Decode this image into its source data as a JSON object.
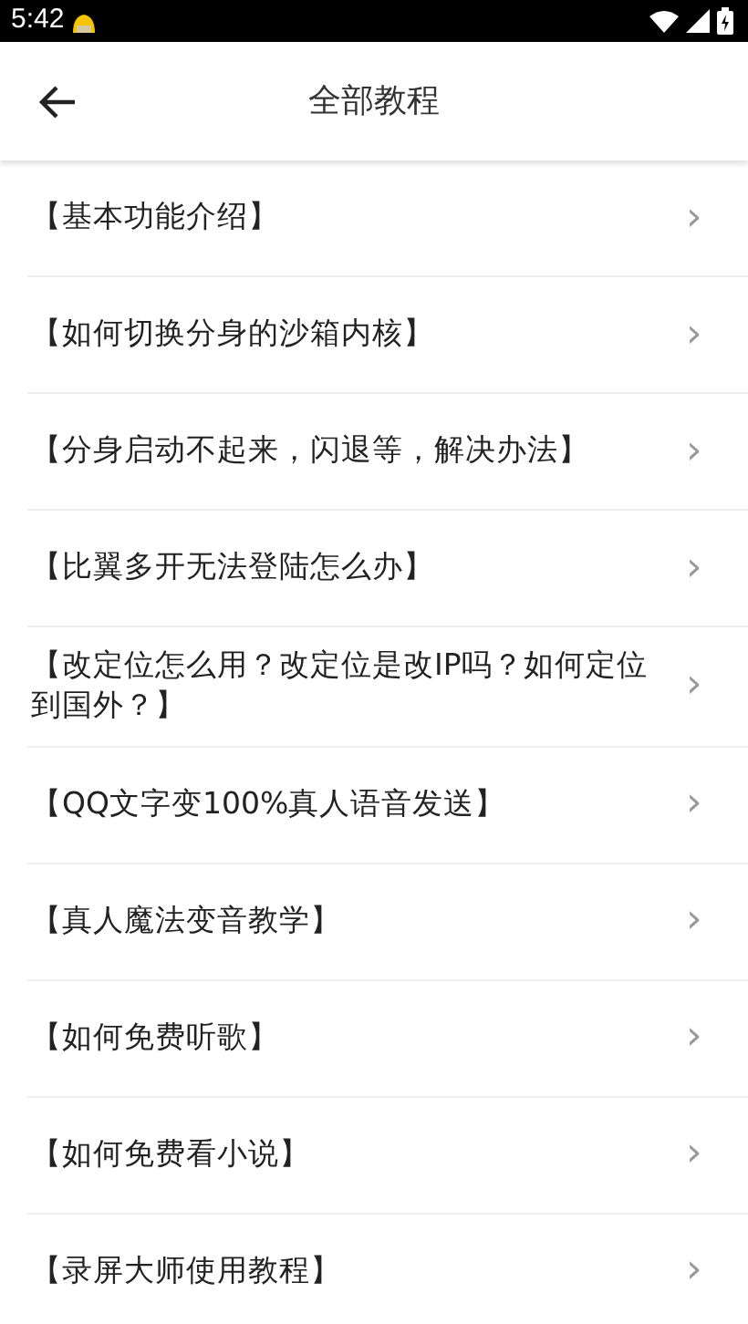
{
  "status_bar": {
    "time": "5:42"
  },
  "header": {
    "title": "全部教程"
  },
  "items": [
    {
      "label": "【基本功能介绍】",
      "chevron": "›"
    },
    {
      "label": "【如何切换分身的沙箱内核】",
      "chevron": "›"
    },
    {
      "label": "【分身启动不起来，闪退等，解决办法】",
      "chevron": "›"
    },
    {
      "label": "【比翼多开无法登陆怎么办】",
      "chevron": "›"
    },
    {
      "label": "【改定位怎么用？改定位是改IP吗？如何定位到国外？】",
      "chevron": "›"
    },
    {
      "label": "【QQ文字变100%真人语音发送】",
      "chevron": "›"
    },
    {
      "label": "【真人魔法变音教学】",
      "chevron": "›"
    },
    {
      "label": "【如何免费听歌】",
      "chevron": "›"
    },
    {
      "label": "【如何免费看小说】",
      "chevron": "›"
    },
    {
      "label": "【录屏大师使用教程】",
      "chevron": "›"
    }
  ]
}
